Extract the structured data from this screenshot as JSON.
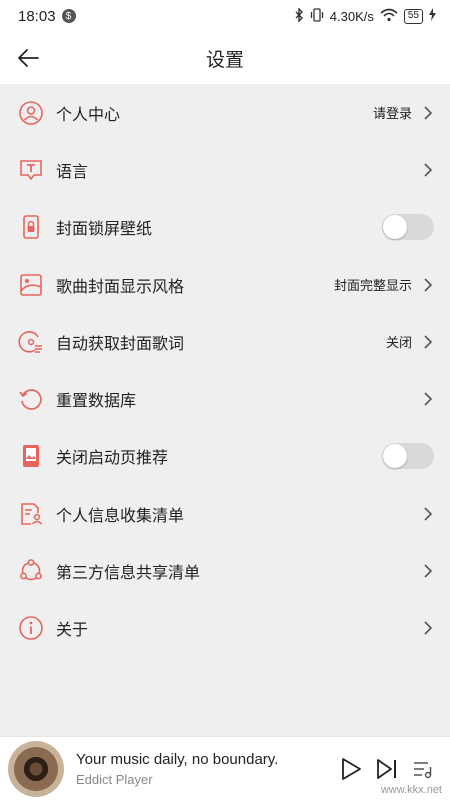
{
  "status_bar": {
    "time": "18:03",
    "app_badge": "$",
    "net_speed": "4.30K/s",
    "battery": "55"
  },
  "header": {
    "title": "设置"
  },
  "settings": [
    {
      "label": "个人中心",
      "value": "请登录",
      "icon": "user-icon",
      "control": "chevron"
    },
    {
      "label": "语言",
      "value": "",
      "icon": "language-icon",
      "control": "chevron"
    },
    {
      "label": "封面锁屏壁纸",
      "value": "",
      "icon": "lockscreen-icon",
      "control": "toggle",
      "on": false
    },
    {
      "label": "歌曲封面显示风格",
      "value": "封面完整显示",
      "icon": "cover-style-icon",
      "control": "chevron"
    },
    {
      "label": "自动获取封面歌词",
      "value": "关闭",
      "icon": "disc-lyrics-icon",
      "control": "chevron"
    },
    {
      "label": "重置数据库",
      "value": "",
      "icon": "reset-icon",
      "control": "chevron"
    },
    {
      "label": "关闭启动页推荐",
      "value": "",
      "icon": "splash-icon",
      "control": "toggle",
      "on": false
    },
    {
      "label": "个人信息收集清单",
      "value": "",
      "icon": "personal-info-icon",
      "control": "chevron"
    },
    {
      "label": "第三方信息共享清单",
      "value": "",
      "icon": "share-icon",
      "control": "chevron"
    },
    {
      "label": "关于",
      "value": "",
      "icon": "info-icon",
      "control": "chevron"
    }
  ],
  "player": {
    "title": "Your music daily, no boundary.",
    "artist": "Eddict Player"
  },
  "watermark": "www.kkx.net",
  "colors": {
    "accent": "#e8655d",
    "background": "#efefef",
    "toggle_off": "#d9d9d9"
  }
}
